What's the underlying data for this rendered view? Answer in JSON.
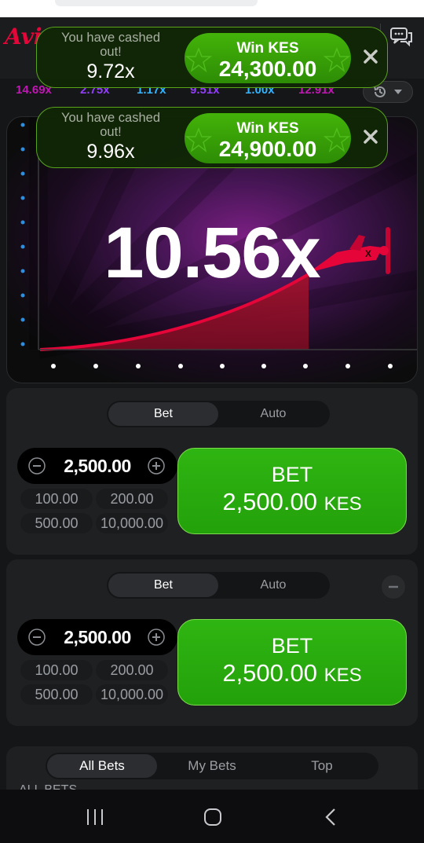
{
  "header": {
    "logo_text": "Avi",
    "chat_icon": "chat-icon"
  },
  "multipliers": [
    {
      "value": "14.69x",
      "color": "#c017b4"
    },
    {
      "value": "2.75x",
      "color": "#913ef8"
    },
    {
      "value": "1.17x",
      "color": "#34b4ff"
    },
    {
      "value": "9.51x",
      "color": "#913ef8"
    },
    {
      "value": "1.00x",
      "color": "#34b4ff"
    },
    {
      "value": "12.91x",
      "color": "#c017b4"
    }
  ],
  "history_icon": "history-icon",
  "toasts": [
    {
      "label": "You have cashed out!",
      "multiplier": "9.72x",
      "win_label": "Win KES",
      "win_amount": "24,300.00"
    },
    {
      "label": "You have cashed out!",
      "multiplier": "9.96x",
      "win_label": "Win KES",
      "win_amount": "24,900.00"
    }
  ],
  "game": {
    "multiplier": "10.56x"
  },
  "bet_panels": [
    {
      "tab_active": "Bet",
      "tab_inactive": "Auto",
      "amount": "2,500.00",
      "chips": [
        "100.00",
        "200.00",
        "500.00",
        "10,000.00"
      ],
      "bet_label": "BET",
      "bet_amount": "2,500.00",
      "currency": "KES"
    },
    {
      "tab_active": "Bet",
      "tab_inactive": "Auto",
      "amount": "2,500.00",
      "chips": [
        "100.00",
        "200.00",
        "500.00",
        "10,000.00"
      ],
      "bet_label": "BET",
      "bet_amount": "2,500.00",
      "currency": "KES"
    }
  ],
  "bets_tabs": [
    "All Bets",
    "My Bets",
    "Top"
  ],
  "bets_heading_partial": "ALL BETS",
  "colors": {
    "brand_red": "#e50539",
    "bet_green": "#28a909",
    "toast_border": "#5aa41a"
  }
}
